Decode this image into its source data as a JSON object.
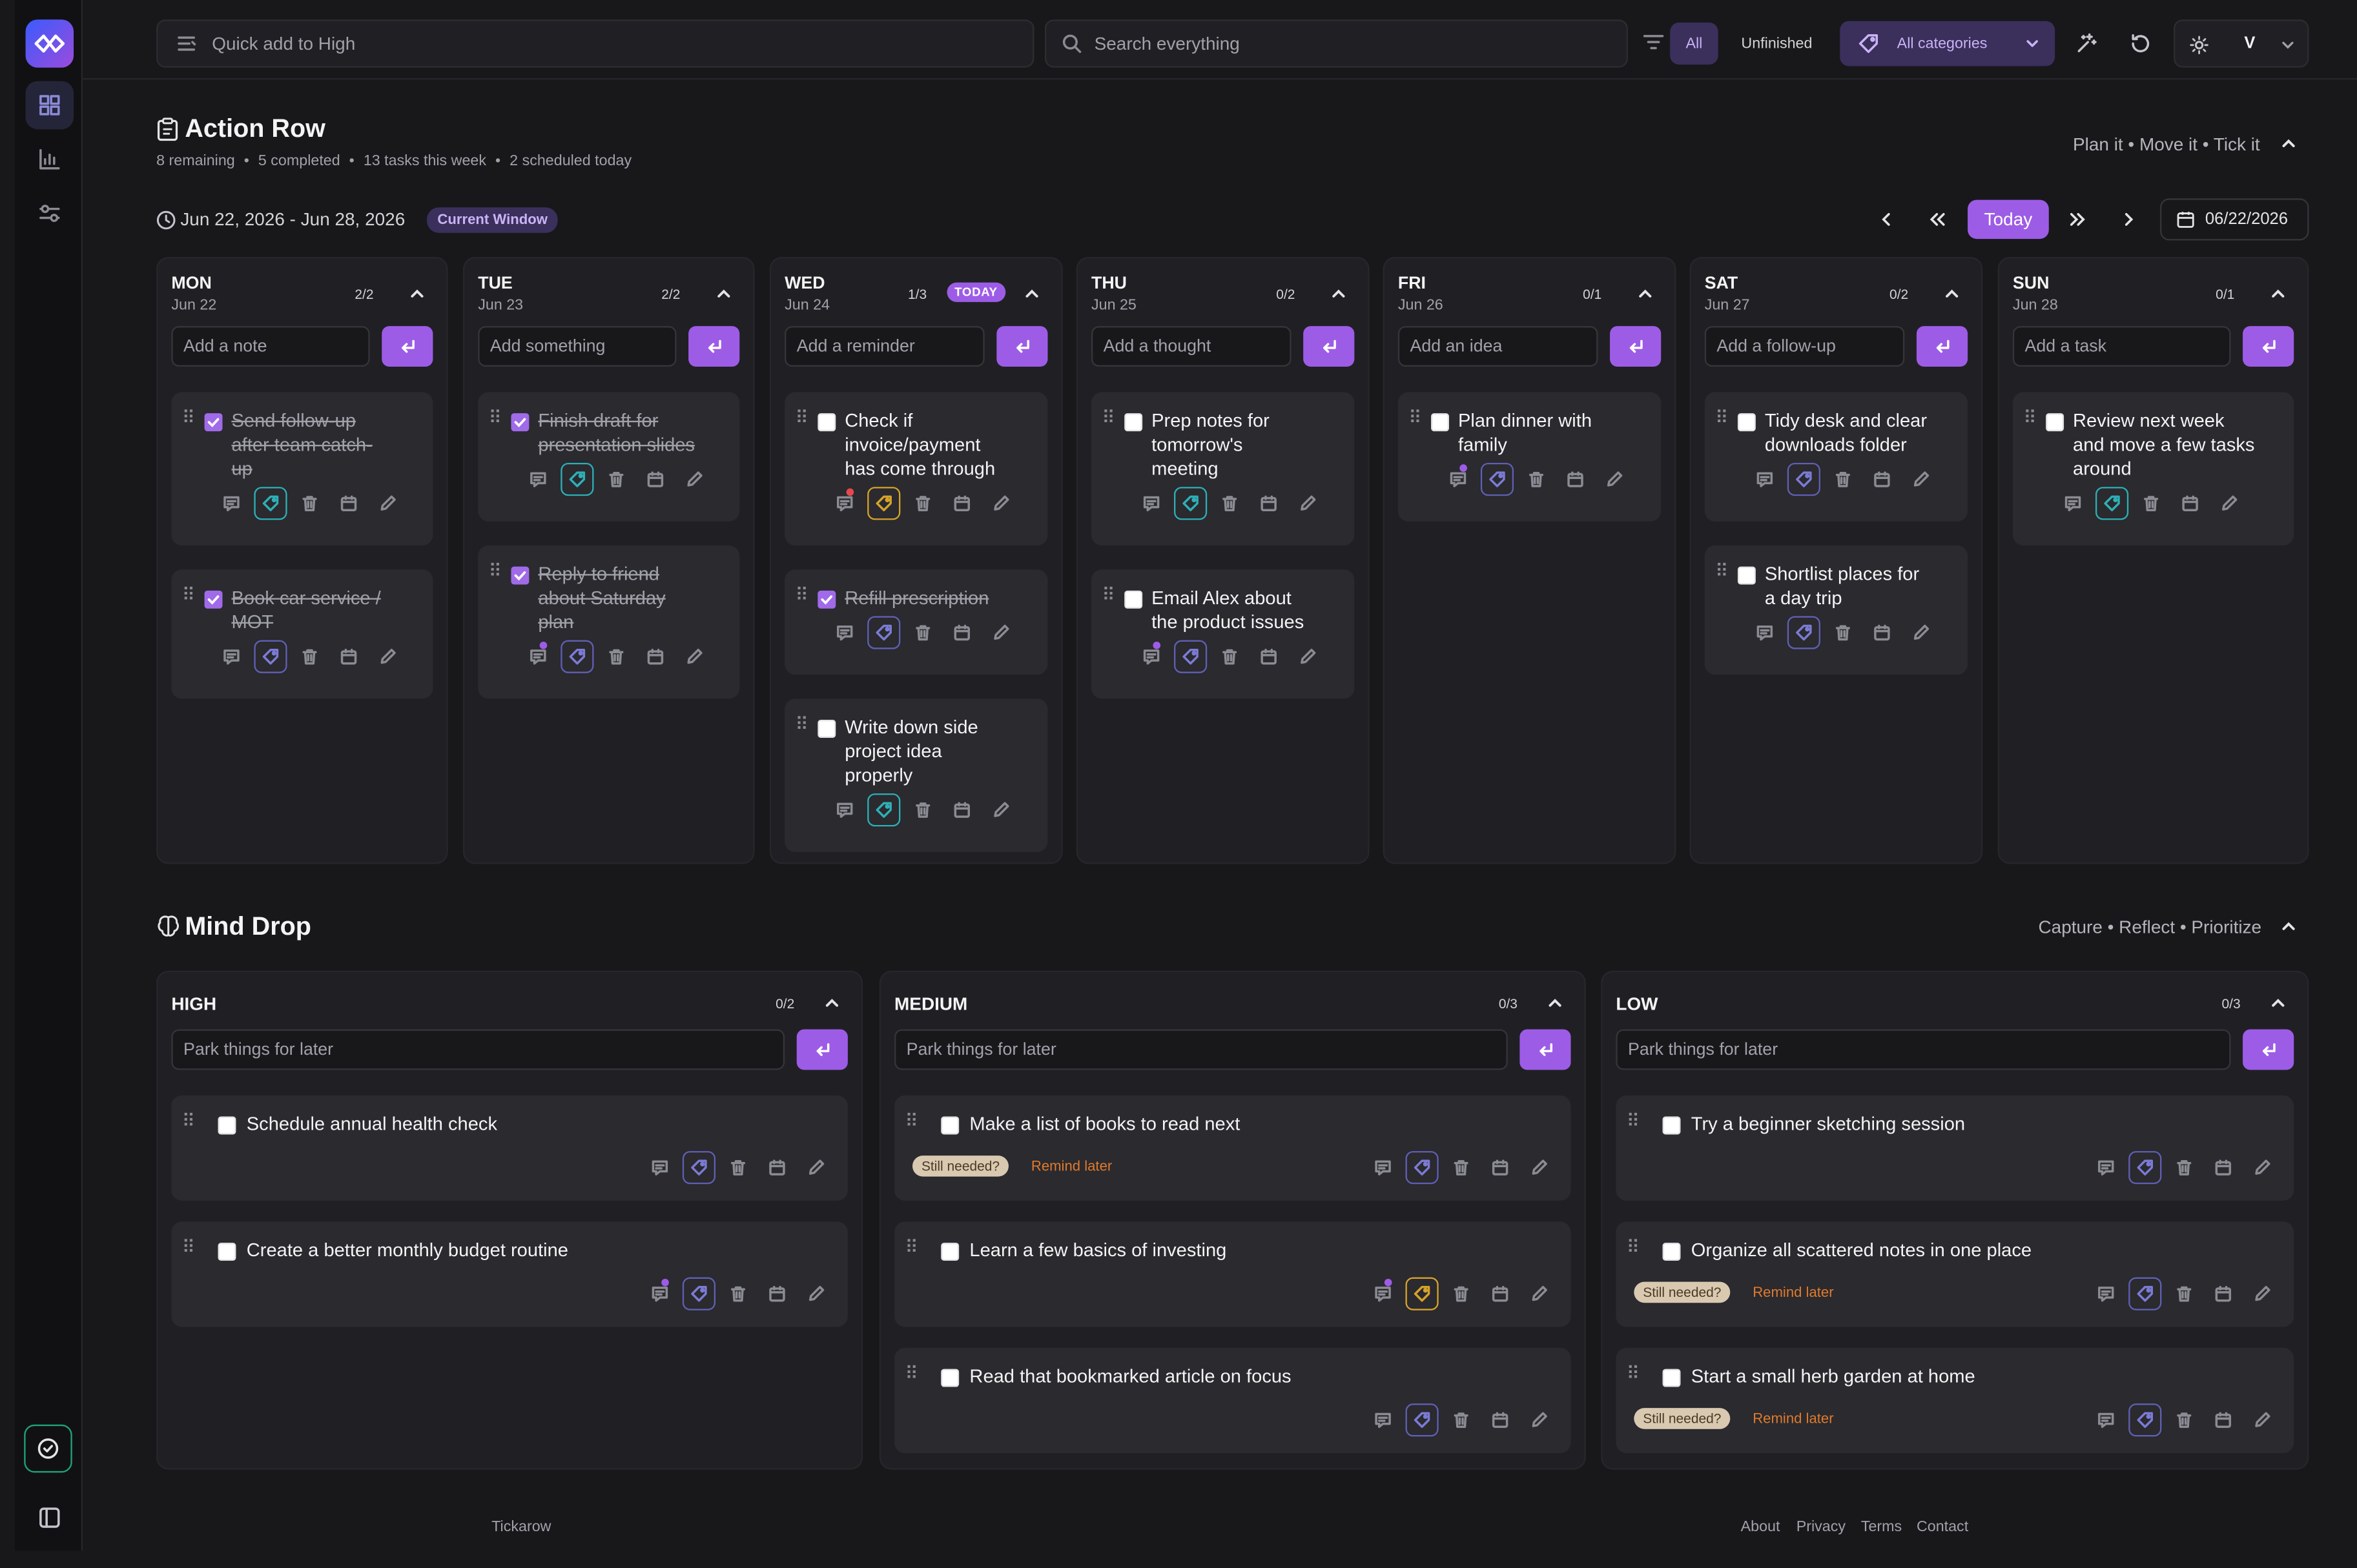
{
  "topbar": {
    "quick_add_placeholder": "Quick add to High",
    "search_placeholder": "Search everything",
    "filter_all": "All",
    "filter_unfinished": "Unfinished",
    "categories": "All categories",
    "user_initial": "V"
  },
  "action_row": {
    "title": "Action Row",
    "stats": [
      "8 remaining",
      "5 completed",
      "13 tasks this week",
      "2 scheduled today"
    ],
    "tagline": "Plan it • Move it • Tick it",
    "range": "Jun 22, 2026 - Jun 28, 2026",
    "window_badge": "Current Window",
    "today_button": "Today",
    "date_value": "06/22/2026",
    "today_badge": "TODAY",
    "days": [
      {
        "name": "MON",
        "date": "Jun 22",
        "count": "2/2",
        "placeholder": "Add a note",
        "tasks": [
          {
            "text": [
              "Send follow-up",
              "after team catch-",
              "up"
            ],
            "done": true
          },
          {
            "text": [
              "Book car service /",
              "MOT"
            ],
            "done": true
          }
        ]
      },
      {
        "name": "TUE",
        "date": "Jun 23",
        "count": "2/2",
        "placeholder": "Add something",
        "tasks": [
          {
            "text": [
              "Finish draft for",
              "presentation slides"
            ],
            "done": true
          },
          {
            "text": [
              "Reply to friend",
              "about Saturday",
              "plan"
            ],
            "done": true
          }
        ]
      },
      {
        "name": "WED",
        "date": "Jun 24",
        "count": "1/3",
        "placeholder": "Add a reminder",
        "tasks": [
          {
            "text": [
              "Check if",
              "invoice/payment",
              "has come through"
            ],
            "done": false
          },
          {
            "text": [
              "Refill prescription"
            ],
            "done": true
          },
          {
            "text": [
              "Write down side",
              "project idea",
              "properly"
            ],
            "done": false
          }
        ]
      },
      {
        "name": "THU",
        "date": "Jun 25",
        "count": "0/2",
        "placeholder": "Add a thought",
        "tasks": [
          {
            "text": [
              "Prep notes for",
              "tomorrow's",
              "meeting"
            ],
            "done": false
          },
          {
            "text": [
              "Email Alex about",
              "the product issues"
            ],
            "done": false
          }
        ]
      },
      {
        "name": "FRI",
        "date": "Jun 26",
        "count": "0/1",
        "placeholder": "Add an idea",
        "tasks": [
          {
            "text": [
              "Plan dinner with",
              "family"
            ],
            "done": false
          }
        ]
      },
      {
        "name": "SAT",
        "date": "Jun 27",
        "count": "0/2",
        "placeholder": "Add a follow-up",
        "tasks": [
          {
            "text": [
              "Tidy desk and clear",
              "downloads folder"
            ],
            "done": false
          },
          {
            "text": [
              "Shortlist places for",
              "a day trip"
            ],
            "done": false
          }
        ]
      },
      {
        "name": "SUN",
        "date": "Jun 28",
        "count": "0/1",
        "placeholder": "Add a task",
        "tasks": [
          {
            "text": [
              "Review next week",
              "and move a few tasks",
              "around"
            ],
            "done": false
          }
        ]
      }
    ]
  },
  "mind_drop": {
    "title": "Mind Drop",
    "tagline": "Capture • Reflect • Prioritize",
    "still_needed": "Still needed?",
    "remind_later": "Remind later",
    "columns": [
      {
        "name": "HIGH",
        "count": "0/2",
        "placeholder": "Park things for later",
        "tasks": [
          "Schedule annual health check",
          "Create a better monthly budget routine"
        ]
      },
      {
        "name": "MEDIUM",
        "count": "0/3",
        "placeholder": "Park things for later",
        "tasks": [
          "Make a list of books to read next",
          "Learn a few basics of investing",
          "Read that bookmarked article on focus"
        ]
      },
      {
        "name": "LOW",
        "count": "0/3",
        "placeholder": "Park things for later",
        "tasks": [
          "Try a beginner sketching session",
          "Organize all scattered notes in one place",
          "Start a small herb garden at home"
        ]
      }
    ]
  },
  "footer": {
    "brand": "Tickarow",
    "links": [
      "About",
      "Privacy",
      "Terms",
      "Contact"
    ]
  },
  "colors": {
    "accent": "#9d5ce6",
    "bg": "#18181b",
    "panel": "#202024",
    "card": "#2a2a2f"
  }
}
